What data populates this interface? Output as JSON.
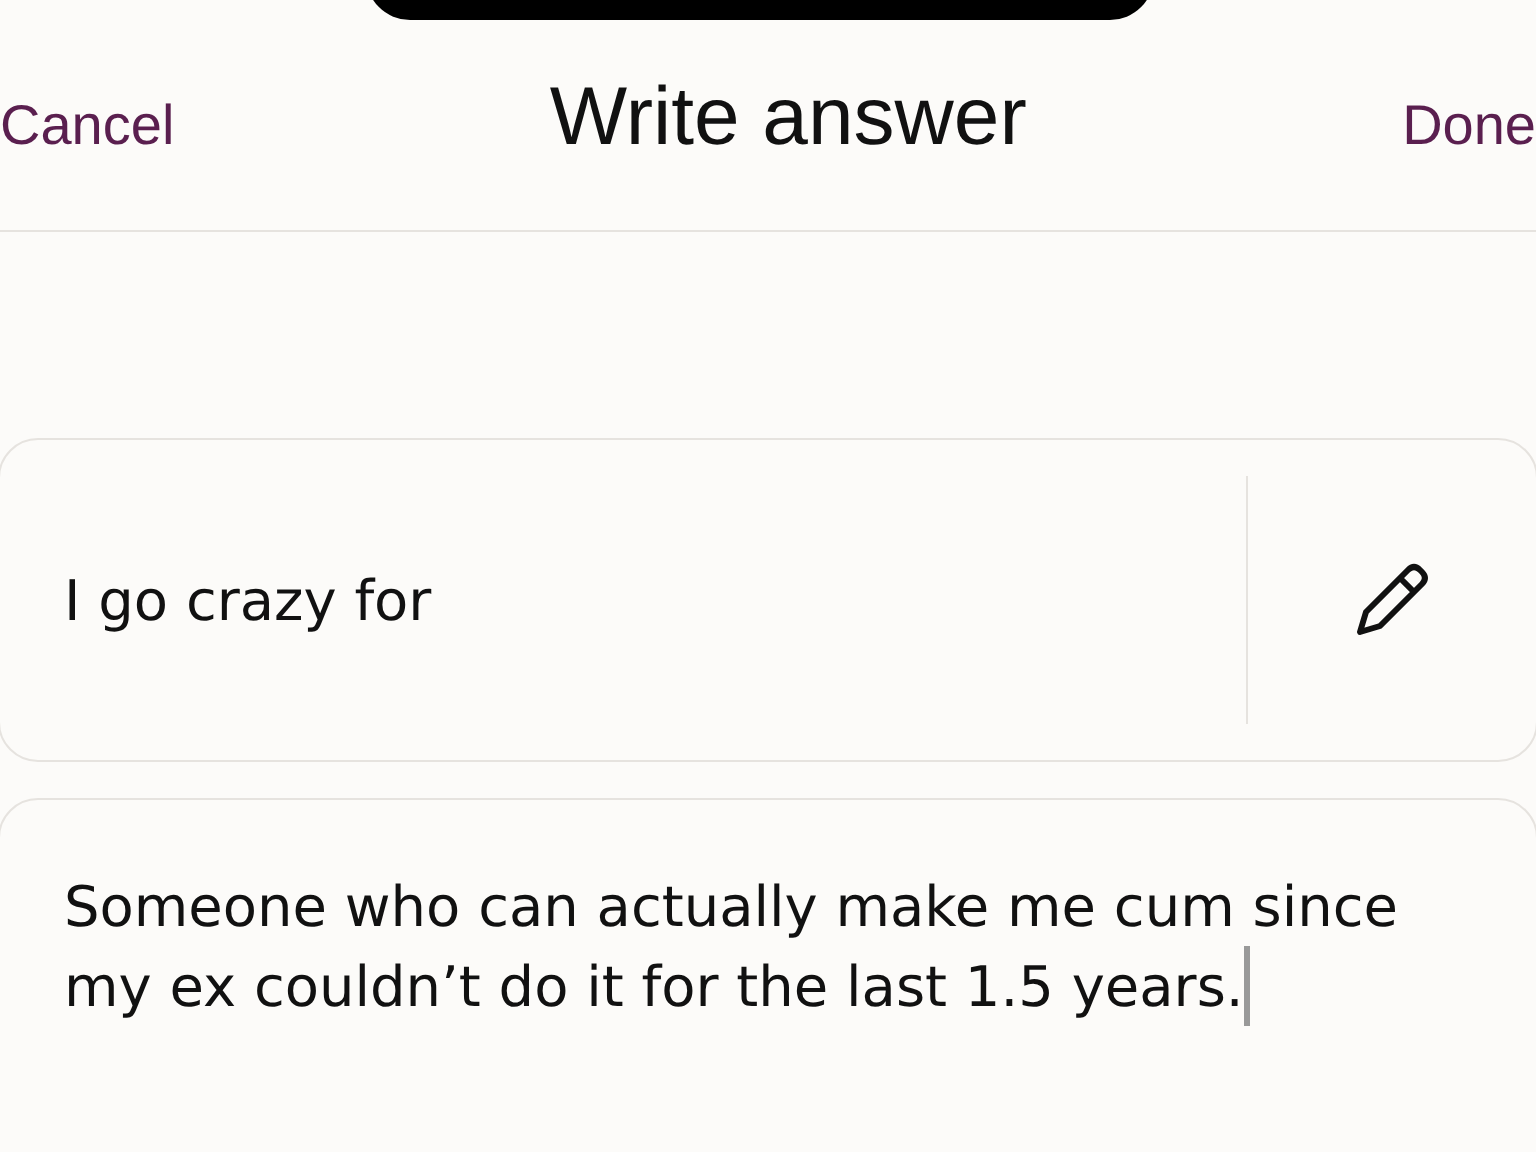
{
  "header": {
    "cancel": "Cancel",
    "title": "Write answer",
    "done": "Done"
  },
  "prompt": {
    "text": "I go crazy for"
  },
  "answer": {
    "value": "Someone who can actually make me cum since my ex couldn’t do it for the last 1.5 years."
  }
}
